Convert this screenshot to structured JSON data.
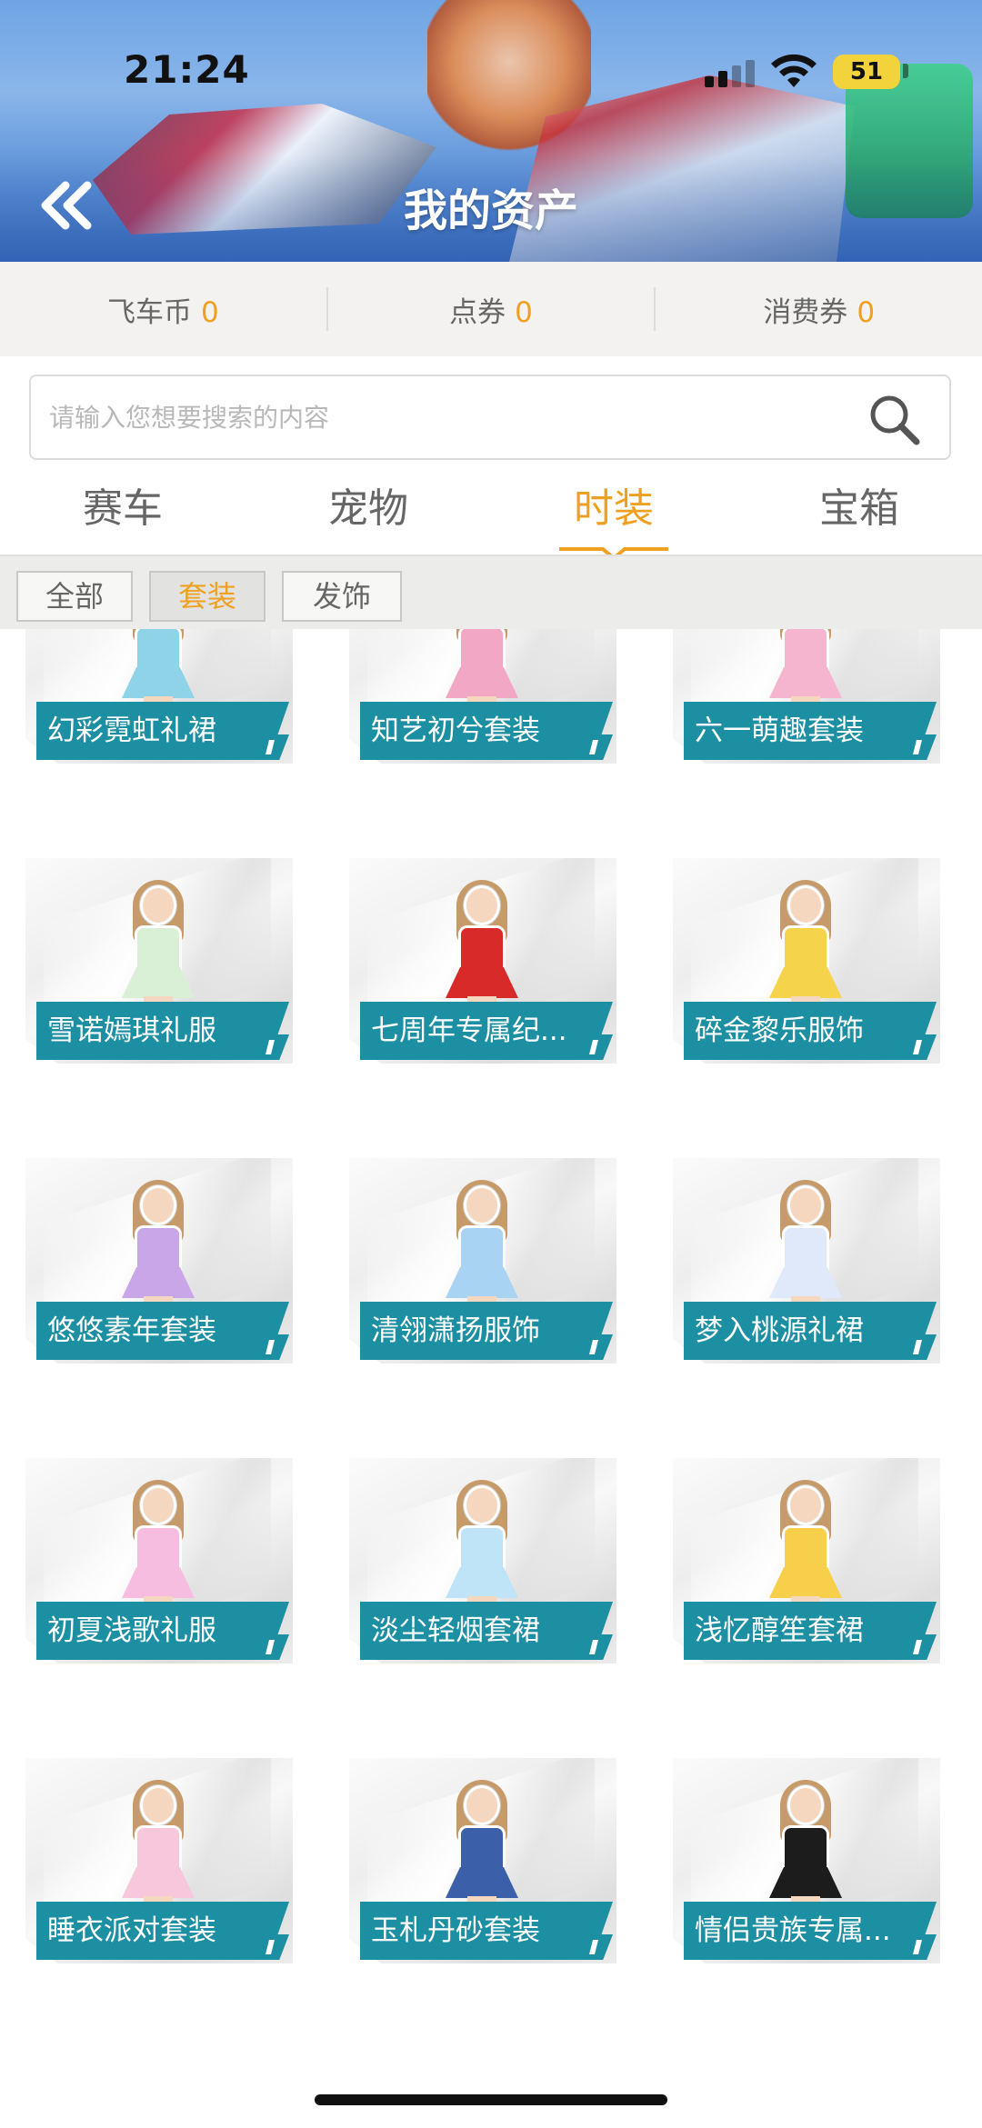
{
  "status_bar": {
    "time": "21:24",
    "battery": "51"
  },
  "header": {
    "title": "我的资产"
  },
  "currency": [
    {
      "label": "飞车币",
      "value": "0"
    },
    {
      "label": "点券",
      "value": "0"
    },
    {
      "label": "消费券",
      "value": "0"
    }
  ],
  "search": {
    "placeholder": "请输入您想要搜索的内容"
  },
  "category_tabs": [
    {
      "label": "赛车",
      "active": false
    },
    {
      "label": "宠物",
      "active": false
    },
    {
      "label": "时装",
      "active": true
    },
    {
      "label": "宝箱",
      "active": false
    }
  ],
  "sub_filters": [
    {
      "label": "全部",
      "active": false
    },
    {
      "label": "套装",
      "active": true
    },
    {
      "label": "发饰",
      "active": false
    }
  ],
  "items": [
    {
      "name": "幻彩霓虹礼裙",
      "color": "#8fd3e8"
    },
    {
      "name": "知艺初兮套装",
      "color": "#f2a7c5"
    },
    {
      "name": "六一萌趣套装",
      "color": "#f6b5cf"
    },
    {
      "name": "雪诺嫣琪礼服",
      "color": "#d9f0d6"
    },
    {
      "name": "七周年专属纪...",
      "color": "#d92a2a"
    },
    {
      "name": "碎金黎乐服饰",
      "color": "#f5d34a"
    },
    {
      "name": "悠悠素年套装",
      "color": "#c9a6e8"
    },
    {
      "name": "清翎潇扬服饰",
      "color": "#a9d3f2"
    },
    {
      "name": "梦入桃源礼裙",
      "color": "#dfe9fa"
    },
    {
      "name": "初夏浅歌礼服",
      "color": "#f7bde0"
    },
    {
      "name": "淡尘轻烟套裙",
      "color": "#bfe3f7"
    },
    {
      "name": "浅忆醇笙套裙",
      "color": "#f7cf4a"
    },
    {
      "name": "睡衣派对套装",
      "color": "#f7c7dc"
    },
    {
      "name": "玉札丹砂套装",
      "color": "#3b5fa8"
    },
    {
      "name": "情侣贵族专属...",
      "color": "#1c1c1c"
    }
  ]
}
